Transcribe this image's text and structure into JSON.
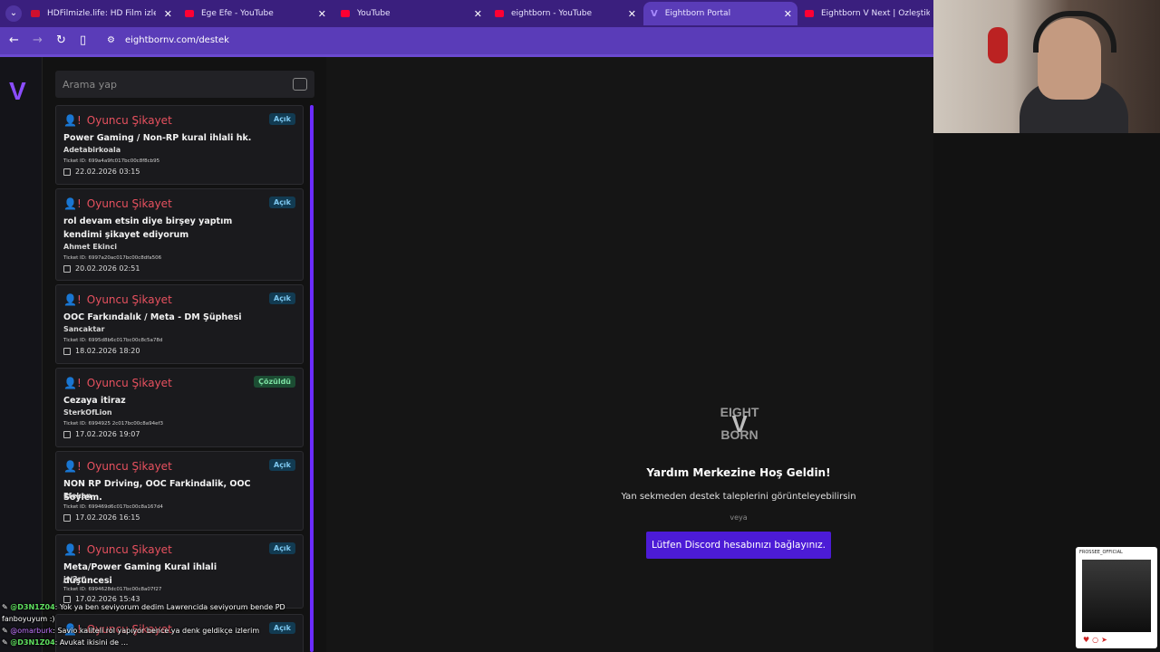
{
  "browser": {
    "tabs": [
      {
        "title": "HDFilmizle.life: HD Film izle, Tü",
        "icon": "hd"
      },
      {
        "title": "Ege Efe - YouTube",
        "icon": "yt"
      },
      {
        "title": "YouTube",
        "icon": "yt"
      },
      {
        "title": "eightborn - YouTube",
        "icon": "yt"
      },
      {
        "title": "Eightborn Portal",
        "icon": "v",
        "active": true
      },
      {
        "title": "Eightborn V Next | Özleştik Kısa",
        "icon": "yt"
      }
    ],
    "url": "eightbornv.com/destek"
  },
  "rail": {
    "logo": "V"
  },
  "search": {
    "placeholder": "Arama yap"
  },
  "tickets": [
    {
      "type": "Oyuncu Şikayet",
      "status": "Açık",
      "subject": "Power Gaming / Non-RP kural ihlali hk.",
      "user": "Adetabirkoala",
      "ticket_id": "Ticket ID: 699a4a9fc017bc00c8f8cb95",
      "date": "22.02.2026 03:15"
    },
    {
      "type": "Oyuncu Şikayet",
      "status": "Açık",
      "subject": "rol devam etsin diye birşey yaptım kendimi şikayet ediyorum",
      "user": "Ahmet Ekinci",
      "ticket_id": "Ticket ID: 6997a20ac017bc00c8dfa506",
      "date": "20.02.2026 02:51"
    },
    {
      "type": "Oyuncu Şikayet",
      "status": "Açık",
      "subject": "OOC Farkındalık / Meta - DM Şüphesi",
      "user": "Sancaktar",
      "ticket_id": "Ticket ID: 6995d8b6c017bc00c8c5a78d",
      "date": "18.02.2026 18:20"
    },
    {
      "type": "Oyuncu Şikayet",
      "status": "Çözüldü",
      "subject": "Cezaya itiraz",
      "user": "SterkOfLion",
      "ticket_id": "Ticket ID: 6994925 2c017bc00c8a94ef3",
      "date": "17.02.2026 19:07"
    },
    {
      "type": "Oyuncu Şikayet",
      "status": "Açık",
      "subject": "NON RP Driving, OOC Farkindalik, OOC Soylem.",
      "user": "Efekan",
      "ticket_id": "Ticket ID: 699469d6c017bc00c8a167d4",
      "date": "17.02.2026 16:15"
    },
    {
      "type": "Oyuncu Şikayet",
      "status": "Açık",
      "subject": "Meta/Power Gaming Kural ihlali düşüncesi",
      "user": "jw3rr",
      "ticket_id": "Ticket ID: 6994628dc017bc00c8a07f27",
      "date": "17.02.2026 15:43"
    },
    {
      "type": "Oyuncu Şikayet",
      "status": "Açık",
      "subject": "",
      "user": "",
      "ticket_id": "",
      "date": ""
    }
  ],
  "main": {
    "logo_line1": "EIGHT",
    "logo_line2": "BORN",
    "welcome": "Yardım Merkezine Hoş Geldin!",
    "subtext": "Yan sekmeden destek taleplerini görünteleyebilirsin",
    "or": "veya",
    "discord_button": "Lütfen Discord hesabınızı bağlayınız."
  },
  "chat": [
    {
      "user": "@D3N1Z04",
      "text": ": Yok ya ben seviyorum dedim Lawrencida seviyorum bende PD fanboyuyum :)"
    },
    {
      "user": "@omarburk",
      "text": ": Savio kaliteli rol yapıyor bence ya denk geldikçe izlerim"
    },
    {
      "user": "@D3N1Z04",
      "text": ": Avukat ikisini de ..."
    }
  ],
  "insta": {
    "handle": "FROSSEE_OFFICIAL"
  },
  "colors": {
    "accent": "#5a3cb8",
    "button": "#4c1bd6",
    "ticket_type": "#e8515f"
  }
}
